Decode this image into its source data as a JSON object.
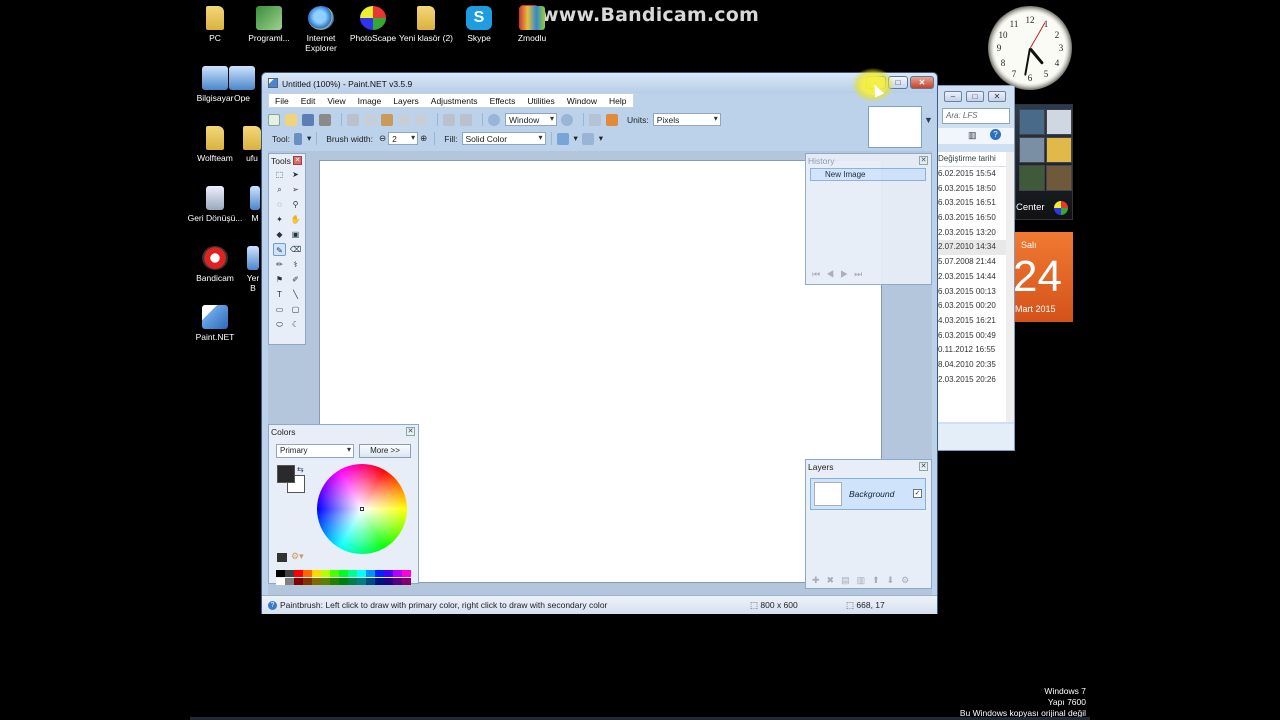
{
  "watermark": "www.Bandicam.com",
  "desktop_icons": [
    {
      "label": "PC",
      "icon": "folder-icon"
    },
    {
      "label": "Programl...",
      "icon": "program-icon"
    },
    {
      "label": "Internet Explorer",
      "icon": "internet-explorer-icon"
    },
    {
      "label": "PhotoScape",
      "icon": "photoscape-icon"
    },
    {
      "label": "Yeni klasör (2)",
      "icon": "folder-icon"
    },
    {
      "label": "Skype",
      "icon": "skype-icon"
    },
    {
      "label": "Zmodlu",
      "icon": "archive-icon"
    },
    {
      "label": "Bilgisayar",
      "icon": "computer-icon"
    },
    {
      "label": "Ope",
      "icon": "app-icon"
    },
    {
      "label": "Wolfteam",
      "icon": "folder-icon"
    },
    {
      "label": "ufu",
      "icon": "folder-icon"
    },
    {
      "label": "Geri Dönüşü...",
      "icon": "recycle-bin-icon"
    },
    {
      "label": "M",
      "icon": "app-icon"
    },
    {
      "label": "Bandicam",
      "icon": "bandicam-icon"
    },
    {
      "label": "Yer B",
      "icon": "app-icon"
    },
    {
      "label": "Paint.NET",
      "icon": "paint-net-icon"
    }
  ],
  "gadgets": {
    "clock_numbers": [
      "12",
      "1",
      "2",
      "3",
      "4",
      "5",
      "6",
      "7",
      "8",
      "9",
      "10",
      "11"
    ],
    "media_center_label": "Center",
    "calendar": {
      "weekday": "Salı",
      "day": "24",
      "month": "Mart 2015"
    }
  },
  "explorer": {
    "search_placeholder": "Ara: LFS",
    "column_header": "Değiştirme tarihi",
    "rows": [
      "6.02.2015 15:54",
      "6.03.2015 18:50",
      "6.03.2015 16:51",
      "6.03.2015 16:50",
      "2.03.2015 13:20",
      "2.07.2010 14:34",
      "5.07.2008 21:44",
      "2.03.2015 14:44",
      "6.03.2015 00:13",
      "6.03.2015 00:20",
      "4.03.2015 16:21",
      "6.03.2015 00:49",
      "0.11.2012 16:55",
      "8.04.2010 20:35",
      "2.03.2015 20:26"
    ]
  },
  "window": {
    "title": "Untitled (100%) - Paint.NET v3.5.9",
    "menu": [
      "File",
      "Edit",
      "View",
      "Image",
      "Layers",
      "Adjustments",
      "Effects",
      "Utilities",
      "Window",
      "Help"
    ],
    "toolbar": {
      "zoom_value": "Window",
      "units_label": "Units:",
      "units_value": "Pixels",
      "tool_label": "Tool:",
      "brush_width_label": "Brush width:",
      "brush_width_value": "2",
      "fill_label": "Fill:",
      "fill_value": "Solid Color"
    },
    "tools_panel": {
      "title": "Tools"
    },
    "history_panel": {
      "title": "History",
      "items": [
        "New Image"
      ]
    },
    "layers_panel": {
      "title": "Layers",
      "items": [
        "Background"
      ]
    },
    "colors_panel": {
      "title": "Colors",
      "mode": "Primary",
      "more_button": "More >>",
      "primary_color": "#2a2a2a",
      "secondary_color": "#ffffff"
    },
    "status": {
      "message": "Paintbrush: Left click to draw with primary color, right click to draw with secondary color",
      "image_size": "800 x 600",
      "cursor_position": "668, 17"
    }
  },
  "windows_info": {
    "line1": "Windows 7",
    "line2": "Yapı 7600",
    "line3": "Bu Windows kopyası orijinal değil"
  }
}
